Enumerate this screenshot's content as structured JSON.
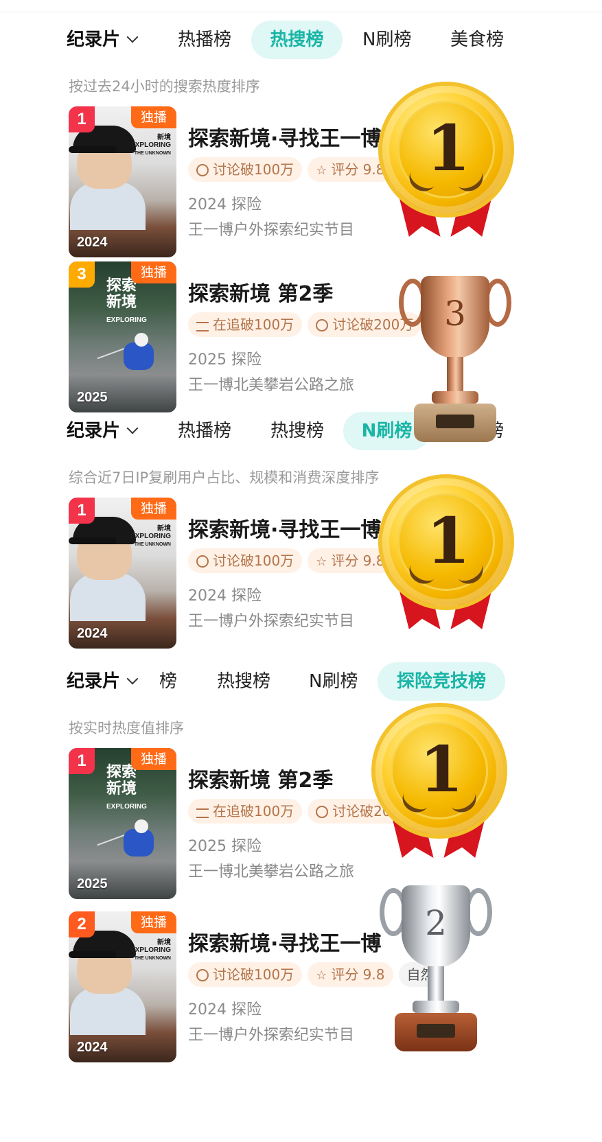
{
  "sections": [
    {
      "tabs": {
        "category": "纪录片",
        "t1": "热播榜",
        "t2": "热搜榜",
        "t3": "N刷榜",
        "t4": "美食榜"
      },
      "active_tab": "热搜榜",
      "subtitle": "按过去24小时的搜索热度排序",
      "items": [
        {
          "rank": "1",
          "badge": "独播",
          "year_label": "2024",
          "title": "探索新境·寻找王一博",
          "tags": [
            "讨论破100万",
            "评分 9.8"
          ],
          "meta": "2024 探险",
          "desc": "王一博户外探索纪实节目",
          "poster_lines": [
            "新境",
            "EXPLORING",
            "THE UNKNOWN"
          ]
        },
        {
          "rank": "3",
          "badge": "独播",
          "year_label": "2025",
          "title": "探索新境 第2季",
          "tags": [
            "在追破100万",
            "讨论破200万"
          ],
          "meta": "2025 探险",
          "desc": "王一博北美攀岩公路之旅",
          "poster_lines": [
            "探索",
            "新境",
            "EXPLORING"
          ]
        }
      ]
    },
    {
      "tabs": {
        "category": "纪录片",
        "t1": "热播榜",
        "t2": "热搜榜",
        "t3": "N刷榜",
        "t4": "美食榜"
      },
      "active_tab": "N刷榜",
      "subtitle": "综合近7日IP复刷用户占比、规模和消费深度排序",
      "items": [
        {
          "rank": "1",
          "badge": "独播",
          "year_label": "2024",
          "title": "探索新境·寻找王一博",
          "tags": [
            "讨论破100万",
            "评分 9.8"
          ],
          "meta": "2024 探险",
          "desc": "王一博户外探索纪实节目",
          "poster_lines": [
            "新境",
            "EXPLORING",
            "THE UNKNOWN"
          ]
        }
      ]
    },
    {
      "tabs": {
        "category": "纪录片",
        "t1": "榜",
        "t2": "热搜榜",
        "t3": "N刷榜",
        "t4": "探险竞技榜"
      },
      "active_tab": "探险竞技榜",
      "subtitle": "按实时热度值排序",
      "items": [
        {
          "rank": "1",
          "badge": "独播",
          "year_label": "2025",
          "title": "探索新境 第2季",
          "tags": [
            "在追破100万",
            "讨论破200万"
          ],
          "meta": "2025 探险",
          "desc": "王一博北美攀岩公路之旅",
          "poster_lines": [
            "探索",
            "新境",
            "EXPLORING"
          ]
        },
        {
          "rank": "2",
          "badge": "独播",
          "year_label": "2024",
          "title": "探索新境·寻找王一博",
          "tags": [
            "讨论破100万",
            "评分 9.8",
            "自然"
          ],
          "meta": "2024 探险",
          "desc": "王一博户外探索纪实节目",
          "poster_lines": [
            "新境",
            "EXPLORING",
            "THE UNKNOWN"
          ]
        }
      ]
    }
  ],
  "awards": {
    "gold": "1",
    "bronze": "3",
    "silver": "2"
  },
  "icons": [
    "chevron-down-icon",
    "comment-icon",
    "star-icon",
    "list-icon",
    "gold-medal-icon",
    "bronze-trophy-icon",
    "silver-trophy-icon"
  ],
  "colors": {
    "active_tab_bg": "#dff7f5",
    "active_tab_text": "#1ab5a6",
    "rank1": "#f2334a",
    "rank2": "#ff5a1f",
    "rank3": "#ffaa00",
    "exclusive_badge": "#ff6a17",
    "tag_bg": "#fff1e6",
    "tag_text": "#b3744a"
  }
}
